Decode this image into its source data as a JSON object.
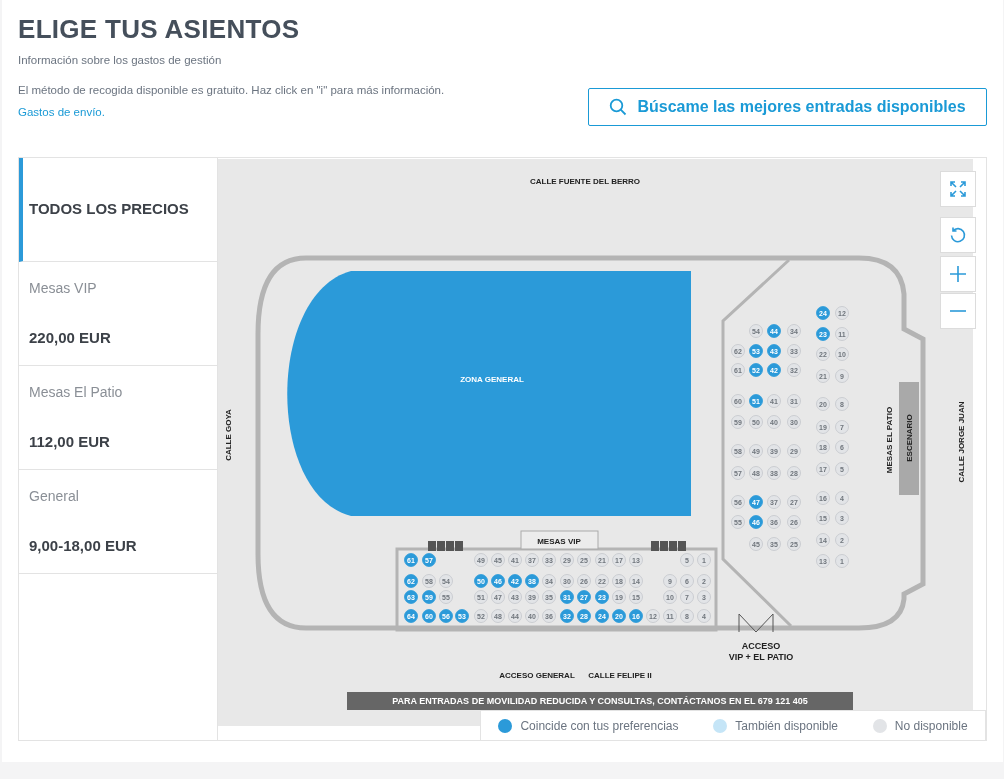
{
  "title": "ELIGE TUS ASIENTOS",
  "fees_link": "Información sobre los gastos de gestión",
  "pickup_note": "El método de recogida disponible es gratuito. Haz click en \"i\" para más información.",
  "shipping_link": "Gastos de envío.",
  "best_seats_button": "Búscame las mejores entradas disponibles",
  "price_filters": [
    {
      "label": "TODOS LOS PRECIOS",
      "selected": true
    },
    {
      "label": "Mesas VIP",
      "price": "220,00 EUR",
      "selected": false
    },
    {
      "label": "Mesas El Patio",
      "price": "112,00 EUR",
      "selected": false
    },
    {
      "label": "General",
      "price": "9,00-18,00 EUR",
      "selected": false
    }
  ],
  "map": {
    "street_top": "CALLE FUENTE DEL BERRO",
    "street_left": "CALLE GOYA",
    "street_right": "CALLE JORGE JUAN",
    "zone_general": "ZONA GENERAL",
    "mesas_vip": "MESAS VIP",
    "mesas_patio": "MESAS EL PATIO",
    "stage": "ESCENARIO",
    "access_vip": [
      "ACCESO",
      "VIP + EL PATIO"
    ],
    "access_general": "ACCESO GENERAL",
    "street_bottom": "CALLE FELIPE II",
    "notice": "PARA ENTRADAS DE MOVILIDAD REDUCIDA Y CONSULTAS, CONTÁCTANOS EN EL 679 121 405",
    "sections": [
      {
        "kind": "patio_left",
        "rows": [
          [
            null,
            {
              "n": "54",
              "kind": "unavailable"
            },
            {
              "n": "44",
              "kind": "match"
            },
            {
              "n": "34",
              "kind": "unavailable"
            }
          ],
          [
            {
              "n": "62",
              "kind": "unavailable"
            },
            {
              "n": "53",
              "kind": "match"
            },
            {
              "n": "43",
              "kind": "match"
            },
            {
              "n": "33",
              "kind": "unavailable"
            }
          ],
          [
            {
              "n": "61",
              "kind": "unavailable"
            },
            {
              "n": "52",
              "kind": "match"
            },
            {
              "n": "42",
              "kind": "match"
            },
            {
              "n": "32",
              "kind": "unavailable"
            }
          ],
          [
            {
              "n": "60",
              "kind": "unavailable"
            },
            {
              "n": "51",
              "kind": "match"
            },
            {
              "n": "41",
              "kind": "unavailable"
            },
            {
              "n": "31",
              "kind": "unavailable"
            }
          ],
          [
            {
              "n": "59",
              "kind": "unavailable"
            },
            {
              "n": "50",
              "kind": "unavailable"
            },
            {
              "n": "40",
              "kind": "unavailable"
            },
            {
              "n": "30",
              "kind": "unavailable"
            }
          ],
          [
            {
              "n": "58",
              "kind": "unavailable"
            },
            {
              "n": "49",
              "kind": "unavailable"
            },
            {
              "n": "39",
              "kind": "unavailable"
            },
            {
              "n": "29",
              "kind": "unavailable"
            }
          ],
          [
            {
              "n": "57",
              "kind": "unavailable"
            },
            {
              "n": "48",
              "kind": "unavailable"
            },
            {
              "n": "38",
              "kind": "unavailable"
            },
            {
              "n": "28",
              "kind": "unavailable"
            }
          ],
          [
            {
              "n": "56",
              "kind": "unavailable"
            },
            {
              "n": "47",
              "kind": "match"
            },
            {
              "n": "37",
              "kind": "unavailable"
            },
            {
              "n": "27",
              "kind": "unavailable"
            }
          ],
          [
            {
              "n": "55",
              "kind": "unavailable"
            },
            {
              "n": "46",
              "kind": "match"
            },
            {
              "n": "36",
              "kind": "unavailable"
            },
            {
              "n": "26",
              "kind": "unavailable"
            }
          ],
          [
            null,
            {
              "n": "45",
              "kind": "unavailable"
            },
            {
              "n": "35",
              "kind": "unavailable"
            },
            {
              "n": "25",
              "kind": "unavailable"
            }
          ]
        ]
      },
      {
        "kind": "patio_right",
        "rows": [
          [
            {
              "n": "24",
              "kind": "match"
            },
            {
              "n": "12",
              "kind": "unavailable"
            }
          ],
          [
            {
              "n": "23",
              "kind": "match"
            },
            {
              "n": "11",
              "kind": "unavailable"
            }
          ],
          [
            {
              "n": "22",
              "kind": "unavailable"
            },
            {
              "n": "10",
              "kind": "unavailable"
            }
          ],
          [
            {
              "n": "21",
              "kind": "unavailable"
            },
            {
              "n": "9",
              "kind": "unavailable"
            }
          ],
          [
            {
              "n": "20",
              "kind": "unavailable"
            },
            {
              "n": "8",
              "kind": "unavailable"
            }
          ],
          [
            {
              "n": "19",
              "kind": "unavailable"
            },
            {
              "n": "7",
              "kind": "unavailable"
            }
          ],
          [
            {
              "n": "18",
              "kind": "unavailable"
            },
            {
              "n": "6",
              "kind": "unavailable"
            }
          ],
          [
            {
              "n": "17",
              "kind": "unavailable"
            },
            {
              "n": "5",
              "kind": "unavailable"
            }
          ],
          [
            {
              "n": "16",
              "kind": "unavailable"
            },
            {
              "n": "4",
              "kind": "unavailable"
            }
          ],
          [
            {
              "n": "15",
              "kind": "unavailable"
            },
            {
              "n": "3",
              "kind": "unavailable"
            }
          ],
          [
            {
              "n": "14",
              "kind": "unavailable"
            },
            {
              "n": "2",
              "kind": "unavailable"
            }
          ],
          [
            {
              "n": "13",
              "kind": "unavailable"
            },
            {
              "n": "1",
              "kind": "unavailable"
            }
          ]
        ]
      },
      {
        "kind": "vip",
        "rows": [
          [
            {
              "n": "61",
              "kind": "match"
            },
            {
              "n": "57",
              "kind": "match"
            },
            null,
            null,
            {
              "n": "49",
              "kind": "unavailable"
            },
            {
              "n": "45",
              "kind": "unavailable"
            },
            {
              "n": "41",
              "kind": "unavailable"
            },
            {
              "n": "37",
              "kind": "unavailable"
            },
            {
              "n": "33",
              "kind": "unavailable"
            },
            {
              "n": "29",
              "kind": "unavailable"
            },
            {
              "n": "25",
              "kind": "unavailable"
            },
            {
              "n": "21",
              "kind": "unavailable"
            },
            {
              "n": "17",
              "kind": "unavailable"
            },
            {
              "n": "13",
              "kind": "unavailable"
            },
            null,
            null,
            {
              "n": "5",
              "kind": "unavailable"
            },
            {
              "n": "1",
              "kind": "unavailable"
            }
          ],
          [
            {
              "n": "62",
              "kind": "match"
            },
            {
              "n": "58",
              "kind": "unavailable"
            },
            {
              "n": "54",
              "kind": "unavailable"
            },
            null,
            {
              "n": "50",
              "kind": "match"
            },
            {
              "n": "46",
              "kind": "match"
            },
            {
              "n": "42",
              "kind": "match"
            },
            {
              "n": "38",
              "kind": "match"
            },
            {
              "n": "34",
              "kind": "unavailable"
            },
            {
              "n": "30",
              "kind": "unavailable"
            },
            {
              "n": "26",
              "kind": "unavailable"
            },
            {
              "n": "22",
              "kind": "unavailable"
            },
            {
              "n": "18",
              "kind": "unavailable"
            },
            {
              "n": "14",
              "kind": "unavailable"
            },
            null,
            {
              "n": "9",
              "kind": "unavailable"
            },
            {
              "n": "6",
              "kind": "unavailable"
            },
            {
              "n": "2",
              "kind": "unavailable"
            }
          ],
          [
            {
              "n": "63",
              "kind": "match"
            },
            {
              "n": "59",
              "kind": "match"
            },
            {
              "n": "55",
              "kind": "unavailable"
            },
            null,
            {
              "n": "51",
              "kind": "unavailable"
            },
            {
              "n": "47",
              "kind": "unavailable"
            },
            {
              "n": "43",
              "kind": "unavailable"
            },
            {
              "n": "39",
              "kind": "unavailable"
            },
            {
              "n": "35",
              "kind": "unavailable"
            },
            {
              "n": "31",
              "kind": "match"
            },
            {
              "n": "27",
              "kind": "match"
            },
            {
              "n": "23",
              "kind": "match"
            },
            {
              "n": "19",
              "kind": "unavailable"
            },
            {
              "n": "15",
              "kind": "unavailable"
            },
            null,
            {
              "n": "10",
              "kind": "unavailable"
            },
            {
              "n": "7",
              "kind": "unavailable"
            },
            {
              "n": "3",
              "kind": "unavailable"
            }
          ],
          [
            {
              "n": "64",
              "kind": "match"
            },
            {
              "n": "60",
              "kind": "match"
            },
            {
              "n": "56",
              "kind": "match"
            },
            {
              "n": "53",
              "kind": "match"
            },
            {
              "n": "52",
              "kind": "unavailable"
            },
            {
              "n": "48",
              "kind": "unavailable"
            },
            {
              "n": "44",
              "kind": "unavailable"
            },
            {
              "n": "40",
              "kind": "unavailable"
            },
            {
              "n": "36",
              "kind": "unavailable"
            },
            {
              "n": "32",
              "kind": "match"
            },
            {
              "n": "28",
              "kind": "match"
            },
            {
              "n": "24",
              "kind": "match"
            },
            {
              "n": "20",
              "kind": "match"
            },
            {
              "n": "16",
              "kind": "match"
            },
            {
              "n": "12",
              "kind": "unavailable"
            },
            {
              "n": "11",
              "kind": "unavailable"
            },
            {
              "n": "8",
              "kind": "unavailable"
            },
            {
              "n": "4",
              "kind": "unavailable"
            }
          ]
        ]
      }
    ]
  },
  "legend": [
    {
      "label": "Coincide con tus preferencias",
      "kind": "match"
    },
    {
      "label": "También disponible",
      "kind": "available"
    },
    {
      "label": "No disponible",
      "kind": "unavailable"
    }
  ]
}
